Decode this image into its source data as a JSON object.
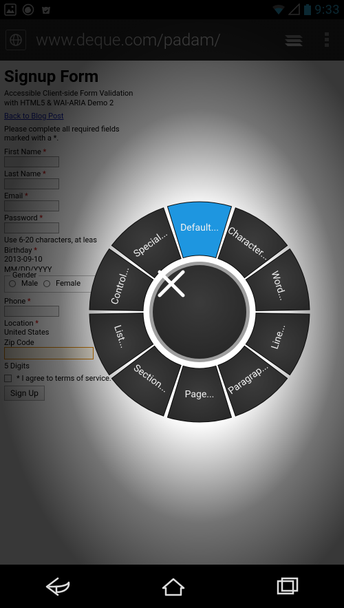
{
  "status": {
    "clock": "9:33"
  },
  "browser": {
    "url": "www.deque.com/padam/"
  },
  "page": {
    "title": "Signup Form",
    "desc1": "Accessible Client-side Form Validation",
    "desc2": "with HTML5 & WAI-ARIA Demo 2",
    "back_link": "Back to Blog Post",
    "instr1": "Please complete all required fields",
    "instr2": "marked with a *.",
    "first_name": "First Name",
    "last_name": "Last Name",
    "email": "Email",
    "password": "Password",
    "pw_hint_prefix": "Use 6-20 characters, at leas",
    "birthday": "Birthday",
    "birthday_value": "2013-09-10",
    "birthday_format": "MM/DD/YYYY",
    "gender_legend": "Gender",
    "male": "Male",
    "female": "Female",
    "phone": "Phone",
    "location": "Location",
    "location_value": "United States",
    "zip": "Zip Code",
    "zip_hint": "5 Digits",
    "terms": "* I agree to terms of service.",
    "signup": "Sign Up"
  },
  "radial": {
    "center_close_aria": "Close",
    "segments": [
      "Default...",
      "Character...",
      "Word...",
      "Line...",
      "Paragrap...",
      "Page...",
      "Section...",
      "List...",
      "Control...",
      "Special..."
    ],
    "active_index": 0
  }
}
